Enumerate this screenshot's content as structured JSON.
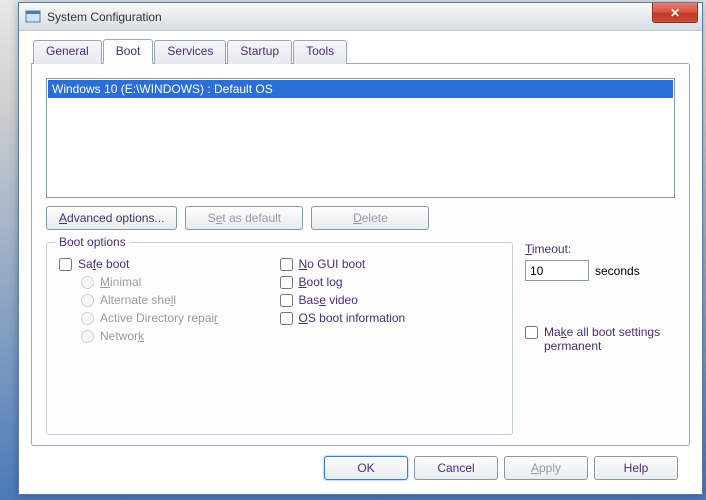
{
  "window": {
    "title": "System Configuration",
    "close_glyph": "✕"
  },
  "tabs": {
    "general": "General",
    "boot": "Boot",
    "services": "Services",
    "startup": "Startup",
    "tools": "Tools"
  },
  "boot_list": {
    "selected": "Windows 10 (E:\\WINDOWS) : Default OS"
  },
  "buttons": {
    "advanced": "Advanced options...",
    "set_default_pre": "S",
    "set_default_u": "e",
    "set_default_post": "t as default",
    "delete_u": "D",
    "delete_post": "elete"
  },
  "group": {
    "boot_options": "Boot options",
    "safe_boot_pre": "Sa",
    "safe_boot_u": "f",
    "safe_boot_post": "e boot",
    "minimal_u": "M",
    "minimal_post": "inimal",
    "altshell_pre": "Alternate she",
    "altshell_u": "l",
    "altshell_post": "l",
    "adrepair_pre": "Active Directory repai",
    "adrepair_u": "r",
    "network_pre": "Networ",
    "network_u": "k",
    "nogui_u": "N",
    "nogui_post": "o GUI boot",
    "bootlog_u": "B",
    "bootlog_post": "oot log",
    "basevideo_pre": "Bas",
    "basevideo_u": "e",
    "basevideo_post": " video",
    "osinfo_u": "O",
    "osinfo_post": "S boot information"
  },
  "timeout": {
    "label_u": "T",
    "label_post": "imeout:",
    "value": "10",
    "unit": "seconds"
  },
  "make_permanent": {
    "pre": "Ma",
    "u": "k",
    "post": "e all boot settings permanent"
  },
  "footer": {
    "ok": "OK",
    "cancel": "Cancel",
    "apply_u": "A",
    "apply_post": "pply",
    "help": "Help"
  }
}
